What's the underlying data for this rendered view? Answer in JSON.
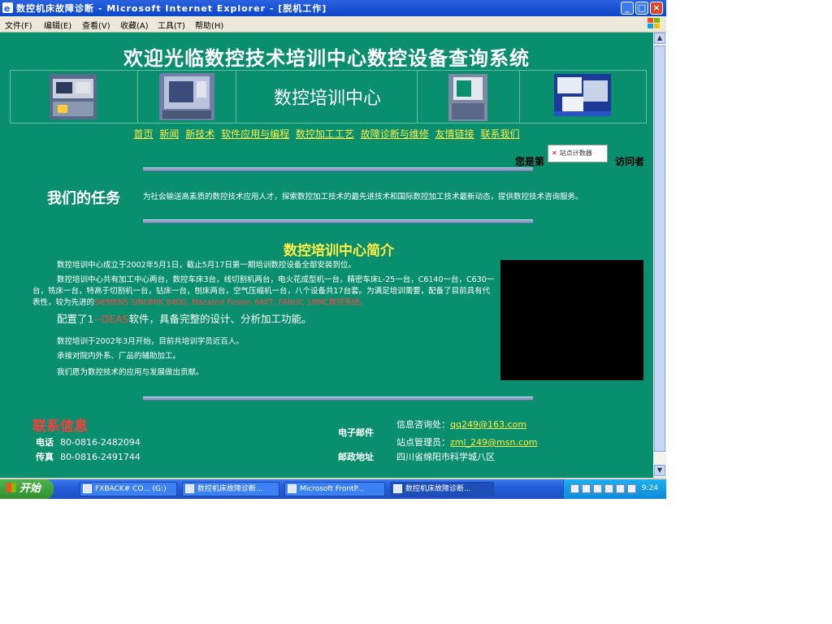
{
  "window": {
    "title": "数控机床故障诊断 - Microsoft Internet Explorer - [脱机工作]"
  },
  "menu": {
    "items": [
      "文件(F)",
      "编辑(E)",
      "查看(V)",
      "收藏(A)",
      "工具(T)",
      "帮助(H)"
    ]
  },
  "page": {
    "site_title": "欢迎光临数控技术培训中心数控设备查询系统",
    "banner_name": "数控培训中心",
    "nav": [
      "首页",
      "新闻",
      "新技术",
      "软件应用与编程",
      "数控加工工艺",
      "故障诊断与维修",
      "友情链接",
      "联系我们"
    ],
    "visitor_prefix": "您是第",
    "visitor_suffix": "访问者",
    "counter_label": "站点计数器",
    "mission_heading": "我们的任务",
    "mission_text": "为社会输送高素质的数控技术应用人才，探索数控加工技术的最先进技术和国际数控加工技术最新动态，提供数控技术咨询服务。",
    "intro_heading": "数控培训中心简介",
    "intro_p1": "数控培训中心成立于2002年5月1日，截止5月17日第一期培训数控设备全部安装到位。",
    "intro_p2": "数控培训中心共有加工中心两台，数控车床3台，线切割机两台，电火花成型机一台，精密车床L-25一台，C6140一台，C630一台，铣床一台，特高于切割机一台，钻床一台，刨床两台，空气压缩机一台，八个设备共17台套。为满足培训需要，配备了目前具有代表性，较为先进的",
    "intro_p2_red": "SIEMENS SINUMIK 840D, Mazatrol Fusion 640T, FANUC 18MC数控系统。",
    "intro_p3_prefix": "配置了1",
    "intro_p3_red": "--DEAS",
    "intro_p3_suffix": "软件，具备完整的设计、分析加工功能。",
    "intro_p4": "数控培训于2002年3月开始，目前共培训学员近百人。",
    "intro_p5": "承接对院内外系、厂品的辅助加工。",
    "intro_p6": "我们愿为数控技术的应用与发展做出贡献。",
    "contact_heading": "联系信息",
    "phone_label": "电话",
    "phone_value": "80-0816-2482094",
    "fax_label": "传真",
    "fax_value": "80-0816-2491744",
    "email_label": "电子邮件",
    "email_info_prefix": "信息咨询处：",
    "email_info_link": "qq249@163.com",
    "email_admin_prefix": "站点管理员：",
    "email_admin_link": "zml_249@msn.com",
    "address_label": "邮政地址",
    "address_value": "四川省绵阳市科学城八区"
  },
  "taskbar": {
    "start_label": "开始",
    "tasks": [
      "FXBACK# CO... (G:)",
      "数控机床故障诊断...",
      "Microsoft FrontP...",
      "数控机床故障诊断..."
    ],
    "clock": "9:24"
  },
  "colors": {
    "page_bg": "#0a8f6e",
    "link_yellow": "#ffee44",
    "highlight_red": "#ff4444",
    "title_bar_blue": "#0a46c8"
  }
}
